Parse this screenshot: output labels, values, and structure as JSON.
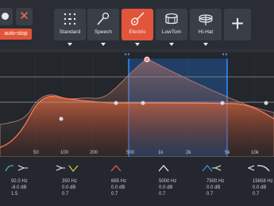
{
  "toolbar": {
    "auto_stop_label": "auto-stop",
    "close_symbol": "✕",
    "add_symbol": "+",
    "presets": [
      {
        "label": "Standard",
        "icon": "dot-grid-icon"
      },
      {
        "label": "Speech",
        "icon": "microphone-icon"
      },
      {
        "label": "Electric",
        "icon": "guitar-icon",
        "active": true
      },
      {
        "label": "LowTom",
        "icon": "drum-icon"
      },
      {
        "label": "Hi-Hat",
        "icon": "cymbal-icon"
      }
    ]
  },
  "graph": {
    "selection_handle_left": "◂ ▸",
    "selection_handle_right": "◂ ▸",
    "freq_labels": [
      "50",
      "100",
      "200",
      "500",
      "1k",
      "2k",
      "5k",
      "10k"
    ]
  },
  "bands": [
    {
      "freq": "92.0 Hz",
      "gain": "-8.0 dB",
      "q": "1.5",
      "icon": "high-pass-curve-icon",
      "color": "#3db8a8"
    },
    {
      "freq": "350 Hz",
      "gain": "0.0 dB",
      "q": "0.7",
      "icon": "low-shelf-curve-icon",
      "color": "#d4c14a"
    },
    {
      "freq": "665 Hz",
      "gain": "0.0 dB",
      "q": "0.7",
      "icon": "bell-curve-icon",
      "color": "#e0555f"
    },
    {
      "freq": "5000 Hz",
      "gain": "0.0 dB",
      "q": "0.7",
      "icon": "bell-curve-icon",
      "color": "#e8e8e8"
    },
    {
      "freq": "7500 Hz",
      "gain": "0.0 dB",
      "q": "0.7",
      "icon": "high-shelf-curve-icon",
      "color": "#3d8fd6"
    },
    {
      "freq": "15658 Hz",
      "gain": "0.0 dB",
      "q": "0.7",
      "icon": "low-pass-curve-icon",
      "color": "#e8e8e8"
    }
  ],
  "colors": {
    "accent": "#e2553a",
    "selection": "#1e6fd0"
  }
}
